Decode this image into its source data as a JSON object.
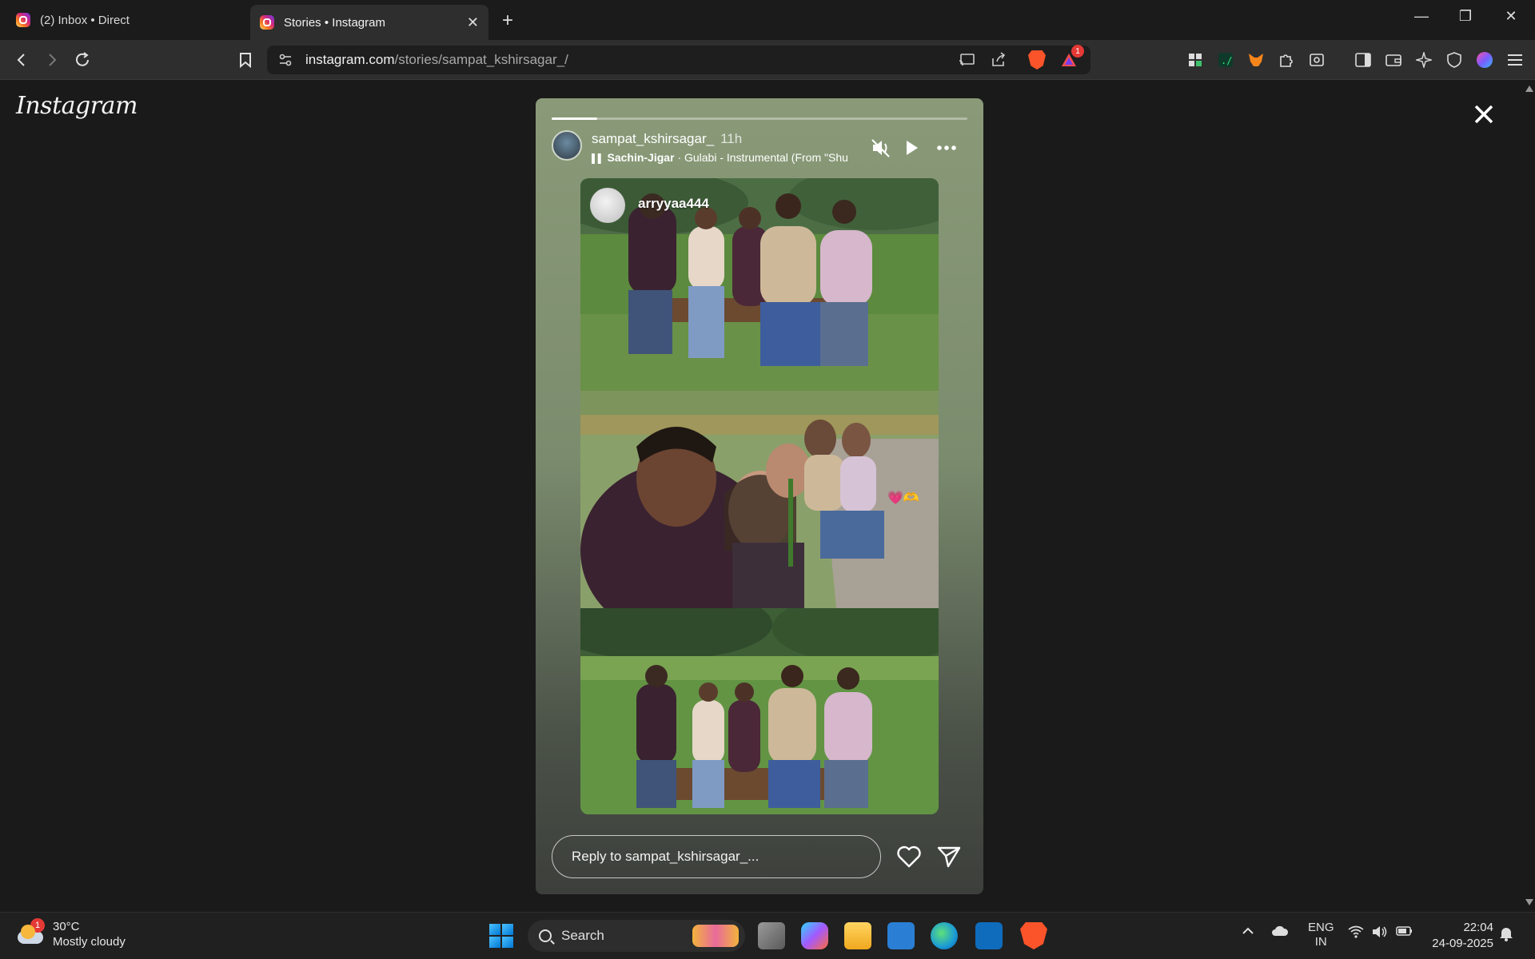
{
  "browser": {
    "tabs": [
      {
        "label": "(2) Inbox • Direct",
        "active": false
      },
      {
        "label": "Stories • Instagram",
        "active": true
      }
    ],
    "url_domain": "instagram.com",
    "url_path": "/stories/sampat_kshirsagar_/",
    "brave_badge_count": "1"
  },
  "page": {
    "logo_text": "Instagram"
  },
  "story": {
    "progress": 0.11,
    "username": "sampat_kshirsagar_",
    "time": "11h",
    "song_artist": "Sachin-Jigar",
    "song_sep": " · ",
    "song_title": "Gulabi - Instrumental (From \"Shu",
    "repost_username": "arryyaa444",
    "sticker": "💗🫶",
    "reply_placeholder": "Reply to sampat_kshirsagar_..."
  },
  "taskbar": {
    "weather_temp": "30°C",
    "weather_desc": "Mostly cloudy",
    "weather_badge": "1",
    "search_label": "Search",
    "lang_line1": "ENG",
    "lang_line2": "IN",
    "time": "22:04",
    "date": "24-09-2025"
  },
  "colors": {
    "page_bg": "#1a1a1a",
    "chrome_bg": "#2e2e2e",
    "story_gradient_top": "#8a9a78",
    "brave_orange": "#fb542b"
  }
}
